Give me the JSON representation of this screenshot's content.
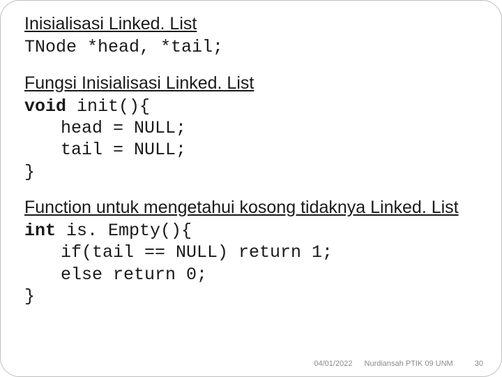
{
  "section1": {
    "heading": "Inisialisasi Linked. List",
    "code": "TNode *head, *tail;"
  },
  "section2": {
    "heading": "Fungsi Inisialisasi Linked. List",
    "sig_kw": "void",
    "sig_rest": " init(){",
    "body1": "head = NULL;",
    "body2": "tail = NULL;",
    "close": "}"
  },
  "section3": {
    "heading": "Function untuk mengetahui kosong tidaknya Linked. List",
    "sig_kw": "int",
    "sig_rest": " is. Empty(){",
    "body1": "if(tail == NULL) return 1;",
    "body2": "else return 0;",
    "close": "}"
  },
  "footer": {
    "date": "04/01/2022",
    "credit": "Nurdiansah PTIK 09 UNM",
    "page": "30"
  }
}
